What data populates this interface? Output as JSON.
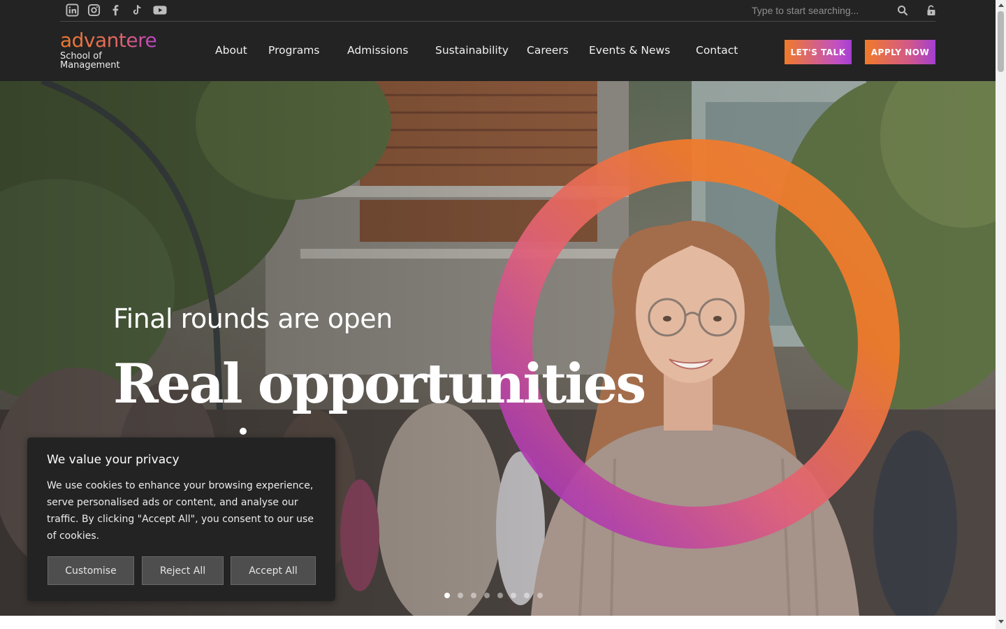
{
  "colors": {
    "header_bg": "#232323",
    "accent_orange": "#f07b2a",
    "accent_purple": "#a33fd0",
    "cookie_bg": "#232323"
  },
  "topbar": {
    "social_icons": [
      "linkedin-icon",
      "instagram-icon",
      "facebook-icon",
      "tiktok-icon",
      "youtube-icon"
    ],
    "search": {
      "placeholder": "Type to start searching...",
      "value": ""
    }
  },
  "logo": {
    "word": "advantere",
    "line1": "School of",
    "line2": "Management"
  },
  "nav": {
    "items": [
      {
        "label": "About"
      },
      {
        "label": "Programs"
      },
      {
        "label": "Admissions"
      },
      {
        "label": "Sustainability"
      },
      {
        "label": "Careers"
      },
      {
        "label": "Events & News"
      },
      {
        "label": "Contact"
      }
    ]
  },
  "cta": {
    "talk": "LET'S TALK",
    "apply": "APPLY NOW"
  },
  "hero": {
    "subtitle": "Final rounds are open",
    "title": "Real opportunities",
    "slides_count": 8,
    "active_slide": 1
  },
  "cookie": {
    "title": "We value your privacy",
    "text": "We use cookies to enhance your browsing experience, serve personalised ads or content, and analyse our traffic. By clicking \"Accept All\", you consent to our use of cookies.",
    "customise": "Customise",
    "reject": "Reject All",
    "accept": "Accept All"
  }
}
